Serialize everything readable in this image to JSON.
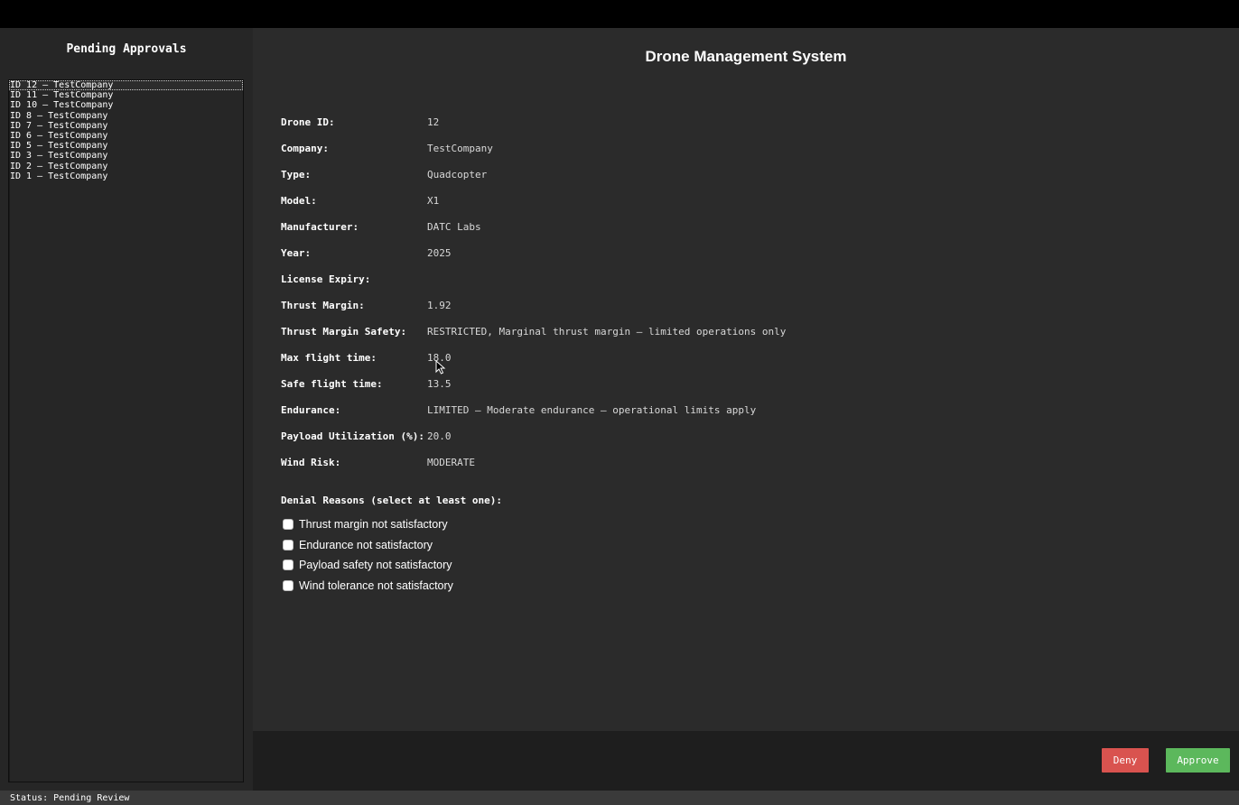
{
  "sidebar": {
    "title": "Pending Approvals",
    "items": [
      "ID 12 — TestCompany",
      "ID 11 — TestCompany",
      "ID 10 — TestCompany",
      "ID 8 — TestCompany",
      "ID 7 — TestCompany",
      "ID 6 — TestCompany",
      "ID 5 — TestCompany",
      "ID 3 — TestCompany",
      "ID 2 — TestCompany",
      "ID 1 — TestCompany"
    ],
    "selected_item": "ID 12 — TestCompany"
  },
  "main": {
    "title": "Drone Management System",
    "fields": [
      {
        "label": "Drone ID:",
        "value": "12"
      },
      {
        "label": "Company:",
        "value": "TestCompany"
      },
      {
        "label": "Type:",
        "value": "Quadcopter"
      },
      {
        "label": "Model:",
        "value": "X1"
      },
      {
        "label": "Manufacturer:",
        "value": "DATC Labs"
      },
      {
        "label": "Year:",
        "value": "2025"
      },
      {
        "label": "License Expiry:",
        "value": ""
      },
      {
        "label": "Thrust Margin:",
        "value": "1.92"
      },
      {
        "label": "Thrust Margin Safety:",
        "value": "RESTRICTED, Marginal thrust margin — limited operations only"
      },
      {
        "label": "Max flight time:",
        "value": "18.0"
      },
      {
        "label": "Safe flight time:",
        "value": "13.5"
      },
      {
        "label": "Endurance:",
        "value": "LIMITED — Moderate endurance — operational limits apply"
      },
      {
        "label": "Payload Utilization (%):",
        "value": "20.0"
      },
      {
        "label": "Wind Risk:",
        "value": "MODERATE"
      }
    ],
    "denial": {
      "heading": "Denial Reasons (select at least one):",
      "options": [
        {
          "label": "Thrust margin not satisfactory",
          "checked": false
        },
        {
          "label": "Endurance not satisfactory",
          "checked": false
        },
        {
          "label": "Payload safety not satisfactory",
          "checked": false
        },
        {
          "label": "Wind tolerance not satisfactory",
          "checked": false
        }
      ]
    }
  },
  "footer": {
    "deny_label": "Deny",
    "approve_label": "Approve",
    "deny_color": "#d9534f",
    "approve_color": "#5cb85c"
  },
  "status": {
    "text": "Status: Pending Review"
  }
}
